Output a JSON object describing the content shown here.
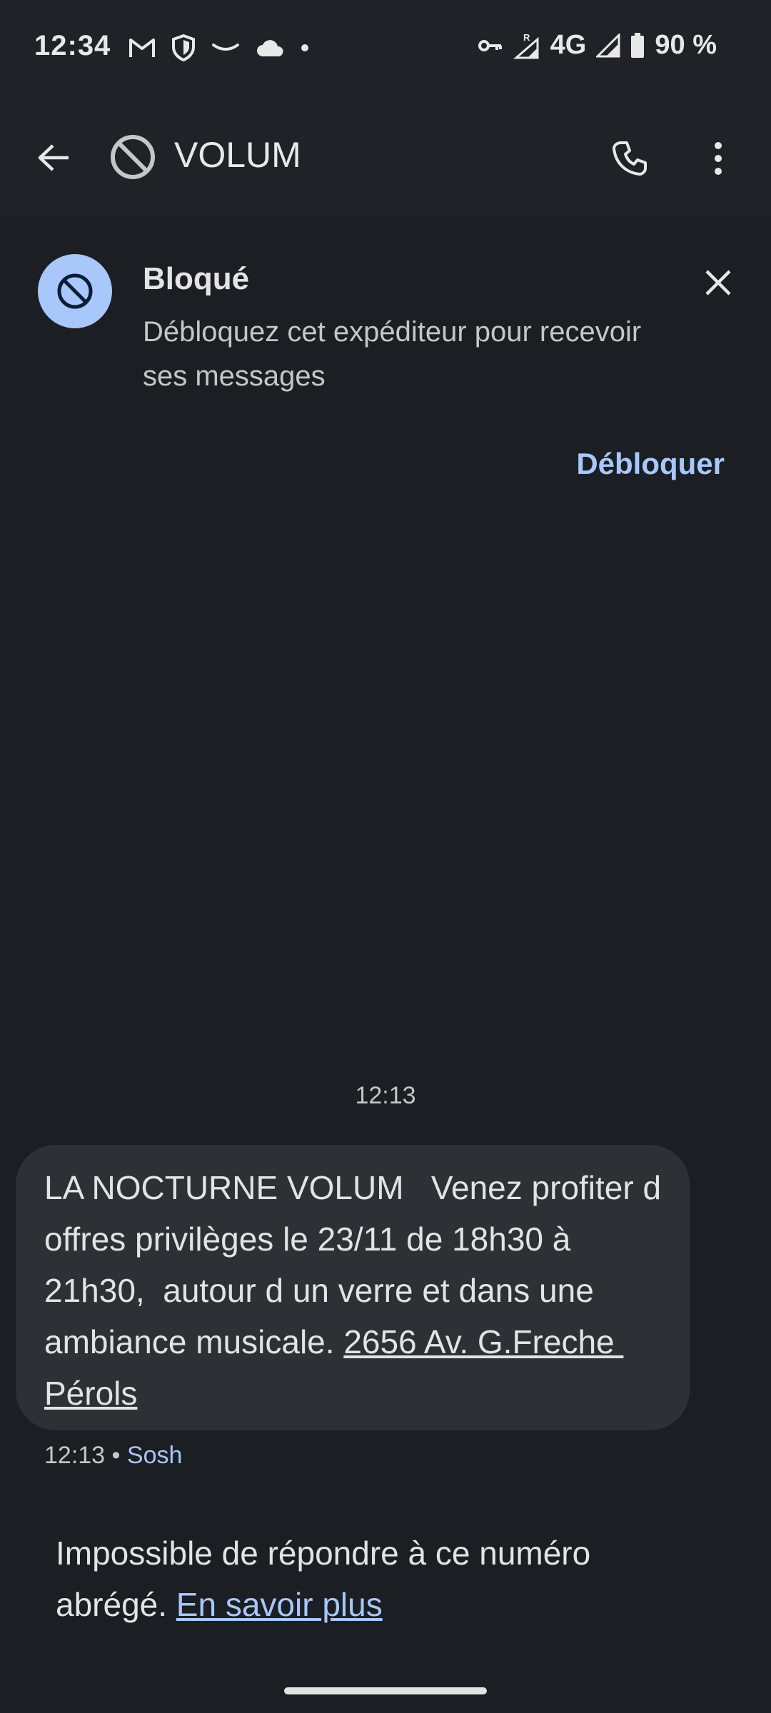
{
  "status_bar": {
    "time": "12:34",
    "network": "4G",
    "roaming_indicator": "R",
    "battery": "90 %",
    "icons_left": [
      "gmail-icon",
      "shield-icon",
      "amazon-icon",
      "cloud-icon",
      "dot-icon"
    ],
    "icons_right": [
      "vpn-key-icon",
      "signal-roaming-icon",
      "signal-icon",
      "battery-icon"
    ]
  },
  "app_bar": {
    "contact_name": "VOLUM",
    "contact_icon": "blocked-icon",
    "actions": [
      "phone-icon",
      "more-vert-icon"
    ]
  },
  "blocked_banner": {
    "title": "Bloqué",
    "description": "Débloquez cet expéditeur pour recevoir ses messages",
    "unblock_label": "Débloquer"
  },
  "conversation": {
    "date_header": "12:13",
    "message": {
      "text": "LA NOCTURNE VOLUM   Venez profiter d offres privilèges le 23/11 de 18h30 à 21h30,  autour d un verre et dans une ambiance musicale. ",
      "link": "2656 Av. G.Freche Pérols",
      "time": "12:13",
      "separator": "•",
      "sim": "Sosh"
    }
  },
  "footer": {
    "note": "Impossible de répondre à ce numéro abrégé. ",
    "link": "En savoir plus"
  },
  "colors": {
    "background": "#1b1e22",
    "accent": "#a8c7fa",
    "bubble": "#2e3035"
  }
}
